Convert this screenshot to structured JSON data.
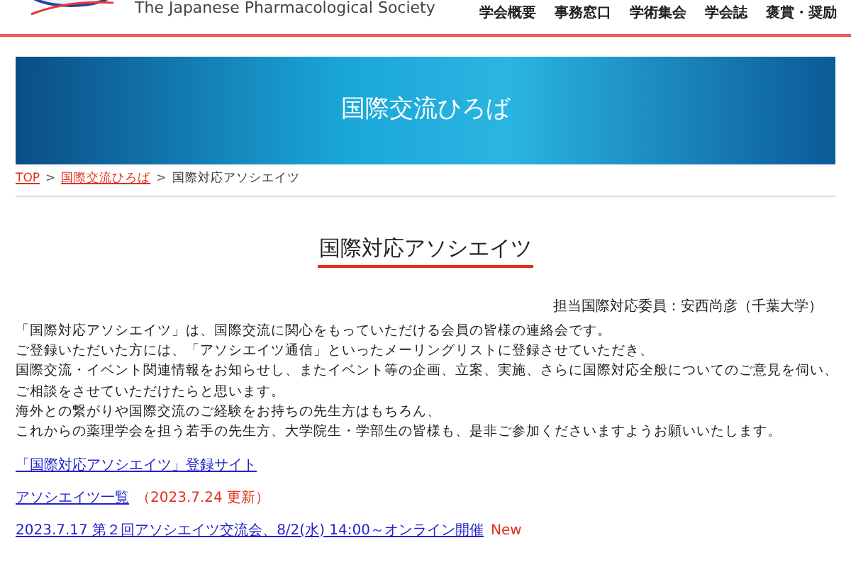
{
  "header": {
    "society_name": "The Japanese Pharmacological Society",
    "nav": [
      {
        "label": "学会概要"
      },
      {
        "label": "事務窓口"
      },
      {
        "label": "学術集会"
      },
      {
        "label": "学会誌"
      },
      {
        "label": "褒賞・奨励"
      }
    ]
  },
  "banner": {
    "title": "国際交流ひろば"
  },
  "breadcrumb_separator": ">",
  "breadcrumb": [
    {
      "label": "TOP",
      "link": true
    },
    {
      "label": "国際交流ひろば",
      "link": true
    },
    {
      "label": "国際対応アソシエイツ",
      "link": false
    }
  ],
  "page_title": "国際対応アソシエイツ",
  "committee": "担当国際対応委員：安西尚彦（千葉大学）",
  "paragraph": [
    "「国際対応アソシエイツ」は、国際交流に関心をもっていただける会員の皆様の連絡会です。",
    "ご登録いただいた方には、「アソシエイツ通信」といったメーリングリストに登録させていただき、",
    "国際交流・イベント関連情報をお知らせし、またイベント等の企画、立案、実施、さらに国際対応全般についてのご意見を伺い、",
    "ご相談をさせていただけたらと思います。",
    "海外との繋がりや国際交流のご経験をお持ちの先生方はもちろん、",
    "これからの薬理学会を担う若手の先生方、大学院生・学部生の皆様も、是非ご参加くださいますようお願いいたします。"
  ],
  "links": [
    {
      "label": "「国際対応アソシエイツ」登録サイト"
    },
    {
      "label": "アソシエイツ一覧",
      "note": "（2023.7.24 更新）"
    },
    {
      "label": "2023.7.17 第２回アソシエイツ交流会、8/2(水) 14:00～オンライン開催",
      "badge": "New"
    }
  ]
}
